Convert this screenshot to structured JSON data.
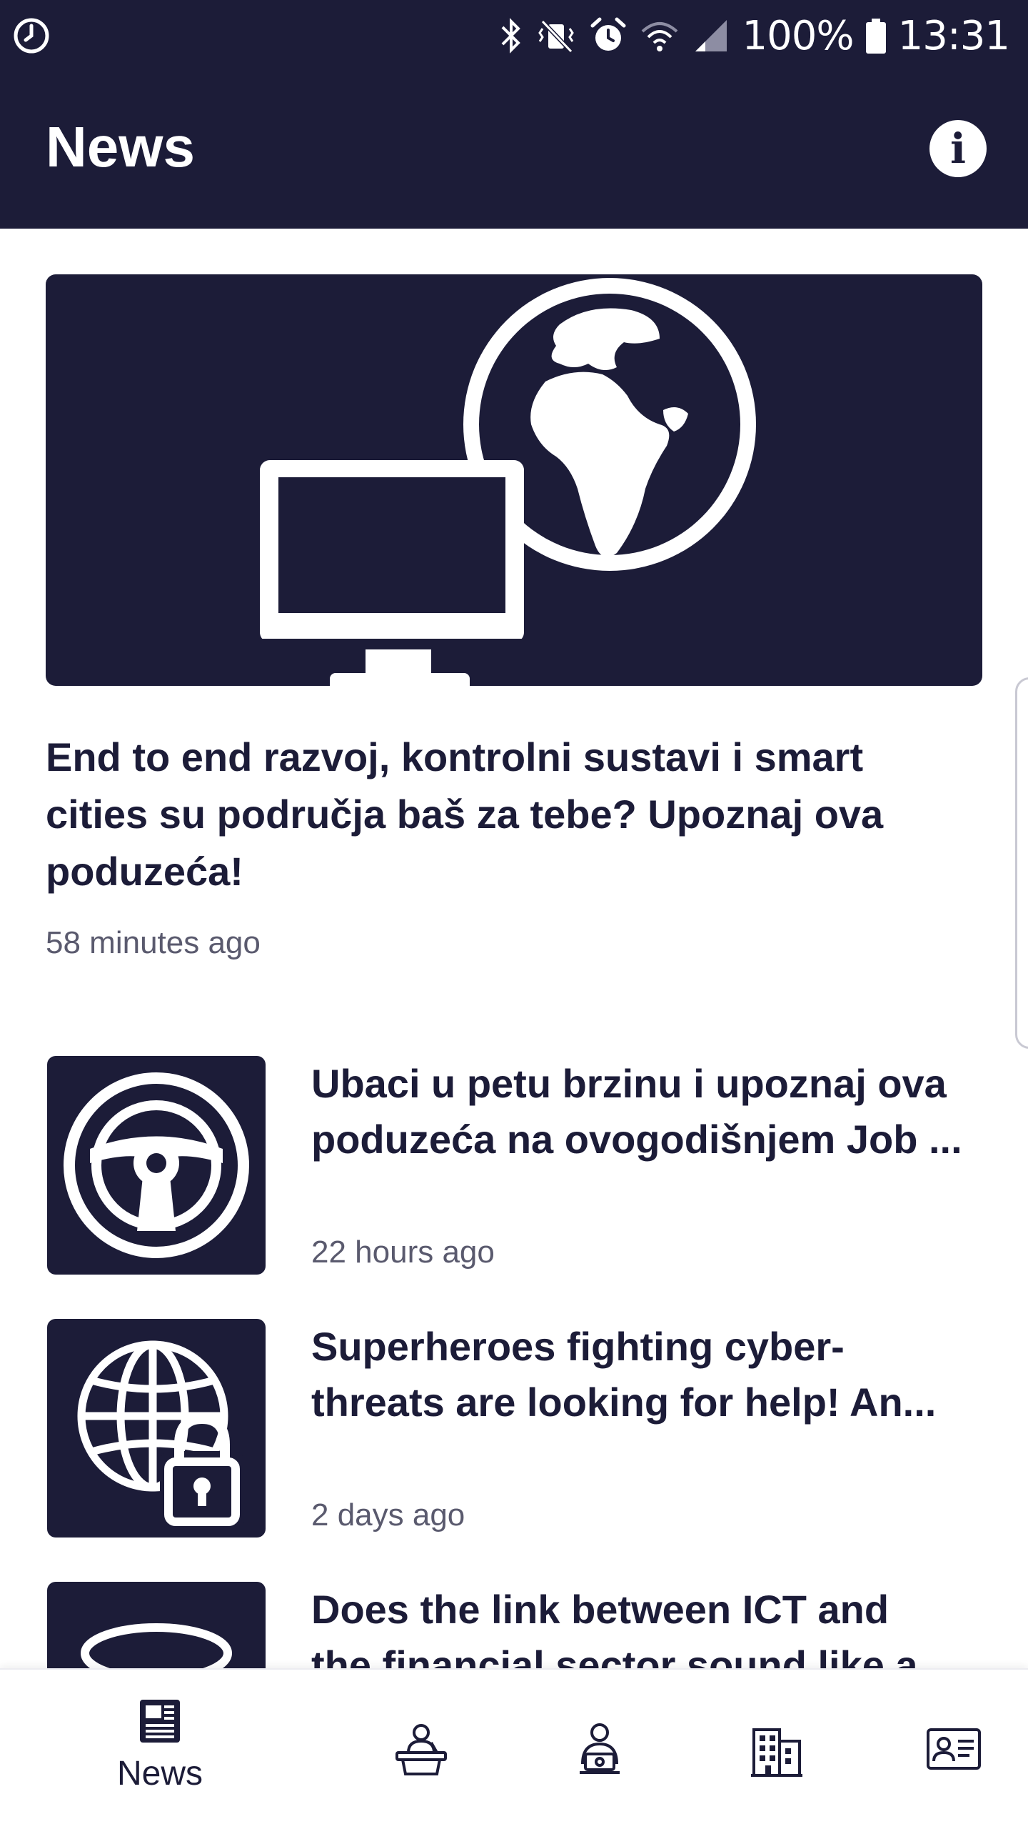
{
  "status_bar": {
    "battery_percent": "100%",
    "time": "13:31",
    "icons": [
      "clock-icon",
      "bluetooth-icon",
      "vibrate-icon",
      "alarm-icon",
      "wifi-icon",
      "cell-signal-icon",
      "battery-icon"
    ]
  },
  "app_bar": {
    "title": "News",
    "info_icon": "info-icon",
    "info_glyph": "i"
  },
  "colors": {
    "primary": "#1c1c38",
    "background": "#ffffff",
    "secondary_text": "#5a5a6e"
  },
  "featured": {
    "image_icon": "monitor-globe-icon",
    "title": "End to end razvoj, kontrolni sustavi i smart cities su područja baš za tebe? Upoznaj ova poduzeća!",
    "time": "58 minutes ago"
  },
  "news_items": [
    {
      "thumb_icon": "steering-wheel-icon",
      "title_lines": [
        "Ubaci u petu brzinu i upoznaj ova",
        "poduzeća na ovogodišnjem Job ..."
      ],
      "time": "22 hours ago"
    },
    {
      "thumb_icon": "globe-lock-icon",
      "title_lines": [
        "Superheroes fighting cyber-",
        "threats are looking for help! An..."
      ],
      "time": "2 days ago"
    },
    {
      "thumb_icon": "database-icon",
      "title_lines": [
        "Does the link between ICT and",
        "the financial sector sound like a"
      ],
      "time": ""
    }
  ],
  "bottom_nav": [
    {
      "icon": "newspaper-icon",
      "label": "News"
    },
    {
      "icon": "speaker-podium-icon",
      "label": ""
    },
    {
      "icon": "person-laptop-icon",
      "label": ""
    },
    {
      "icon": "building-icon",
      "label": ""
    },
    {
      "icon": "id-card-icon",
      "label": ""
    }
  ]
}
